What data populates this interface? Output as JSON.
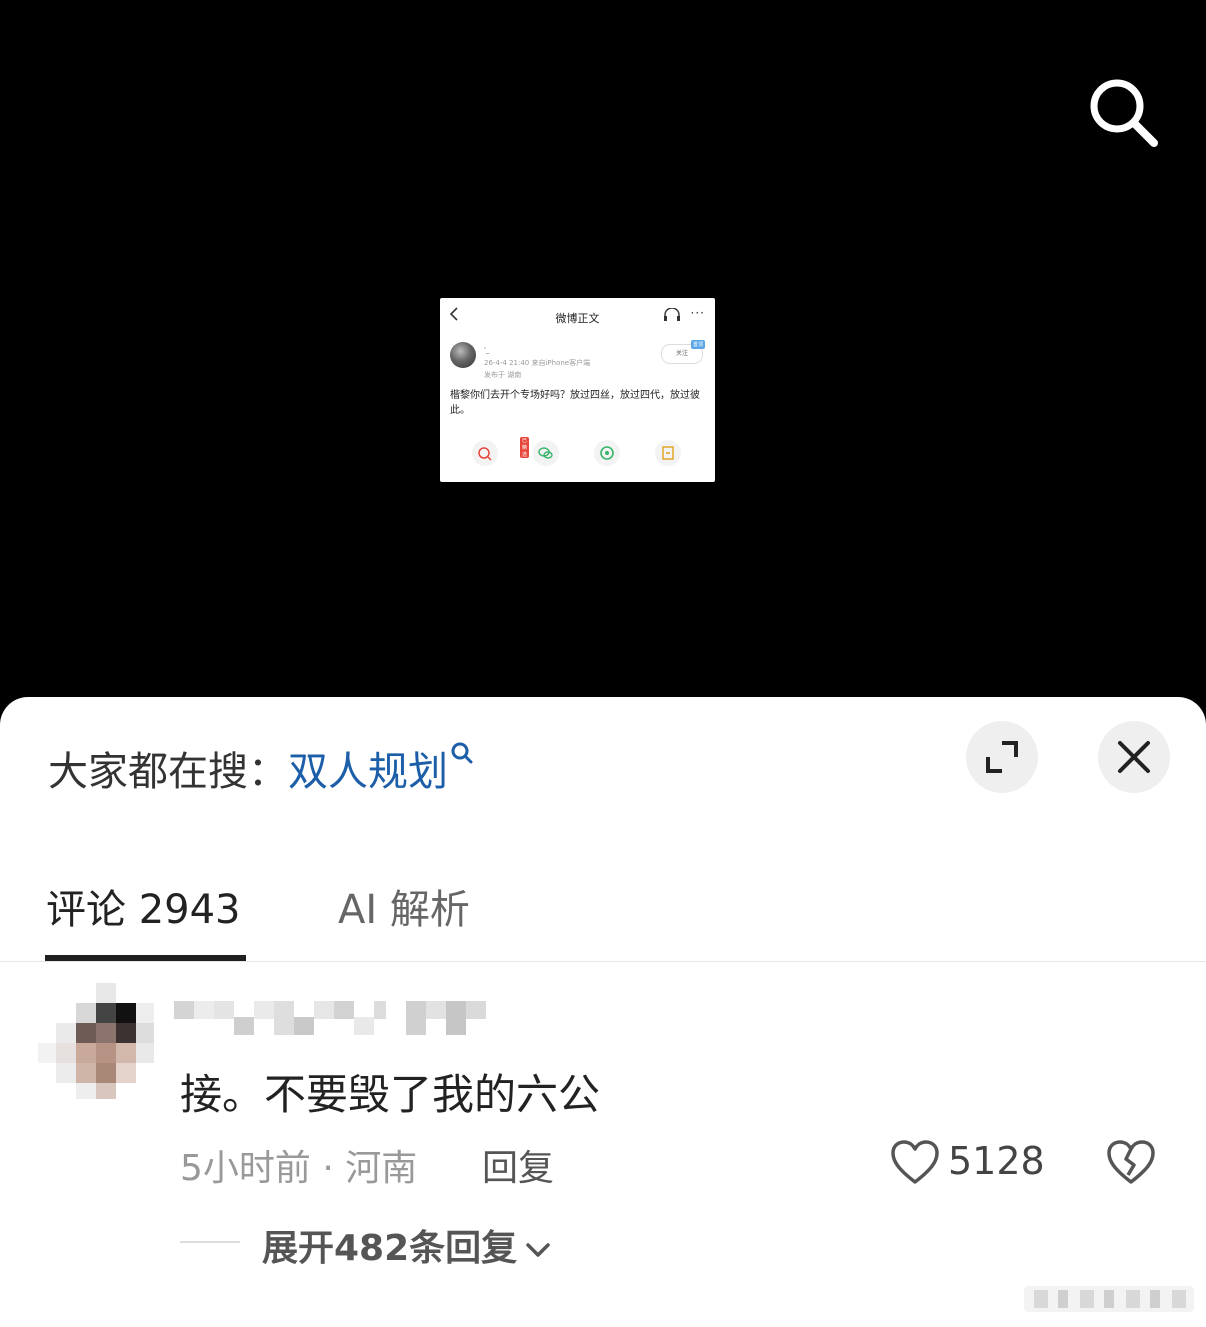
{
  "embed": {
    "title": "微博正文",
    "more": "···",
    "listen_label": "听",
    "meta1": "'_",
    "meta2": "26-4-4 21:40 来自iPhone客户端",
    "meta3": "发布于 湖南",
    "follow_label": "关注",
    "tag": "置顶",
    "body": "楷黎你们去开个专场好吗？放过四丝，放过四代，放过彼此。",
    "badge": "已精选"
  },
  "sheet": {
    "hot_prefix": "大家都在搜：",
    "hot_keyword": "双人规划"
  },
  "tabs": [
    {
      "label": "评论 2943",
      "active": true
    },
    {
      "label": "AI 解析",
      "active": false
    }
  ],
  "comment": {
    "text": "接。不要毁了我的六公",
    "meta": "5小时前 · 河南",
    "reply_label": "回复",
    "like_count": "5128",
    "expand_label": "展开482条回复"
  },
  "colors": {
    "keyword": "#1c5fa8",
    "background_top": "#000000",
    "sheet": "#ffffff"
  }
}
